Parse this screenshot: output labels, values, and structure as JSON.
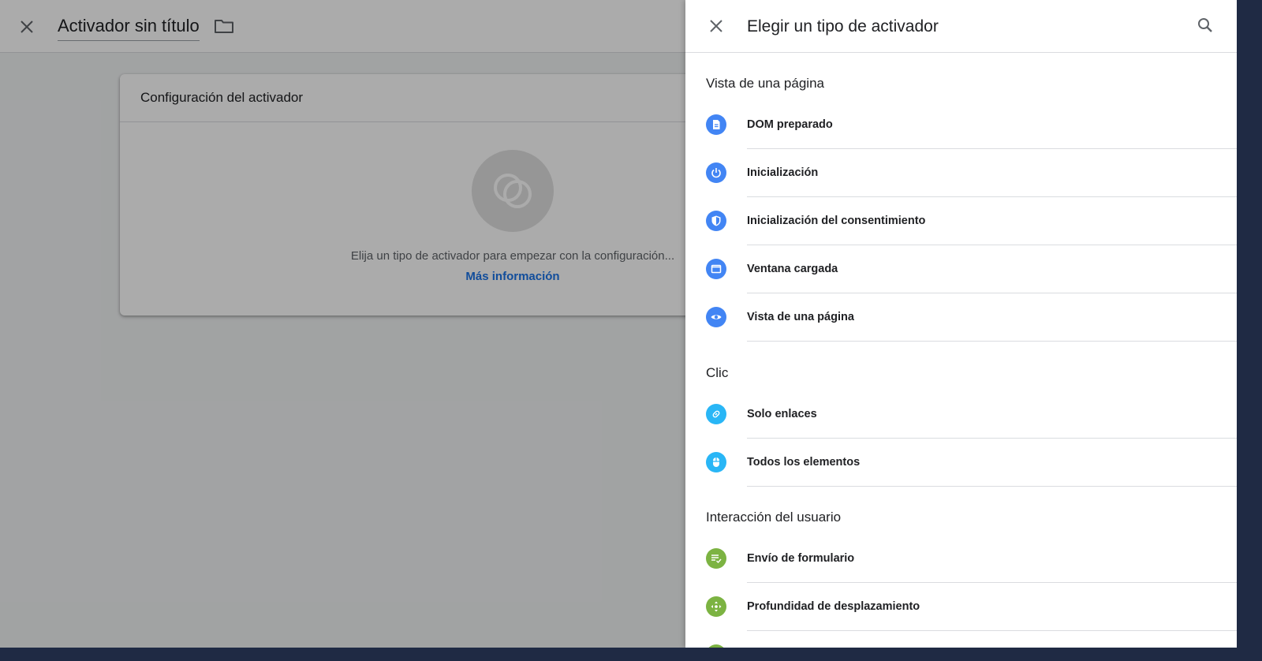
{
  "editor": {
    "title": "Activador sin título",
    "card": {
      "title": "Configuración del activador",
      "hint": "Elija un tipo de activador para empezar con la configuración...",
      "link": "Más información"
    }
  },
  "panel": {
    "title": "Elegir un tipo de activador",
    "sections": [
      {
        "title": "Vista de una página",
        "items": [
          {
            "label": "DOM preparado",
            "icon": "document-icon",
            "color": "#4285f4"
          },
          {
            "label": "Inicialización",
            "icon": "power-icon",
            "color": "#4285f4"
          },
          {
            "label": "Inicialización del consentimiento",
            "icon": "shield-icon",
            "color": "#4285f4"
          },
          {
            "label": "Ventana cargada",
            "icon": "window-icon",
            "color": "#4285f4"
          },
          {
            "label": "Vista de una página",
            "icon": "eye-icon",
            "color": "#4285f4"
          }
        ]
      },
      {
        "title": "Clic",
        "items": [
          {
            "label": "Solo enlaces",
            "icon": "link-icon",
            "color": "#29b6f6"
          },
          {
            "label": "Todos los elementos",
            "icon": "mouse-icon",
            "color": "#29b6f6"
          }
        ]
      },
      {
        "title": "Interacción del usuario",
        "items": [
          {
            "label": "Envío de formulario",
            "icon": "form-check-icon",
            "color": "#7cb342"
          },
          {
            "label": "Profundidad de desplazamiento",
            "icon": "move-arrows-icon",
            "color": "#7cb342"
          }
        ]
      }
    ]
  }
}
